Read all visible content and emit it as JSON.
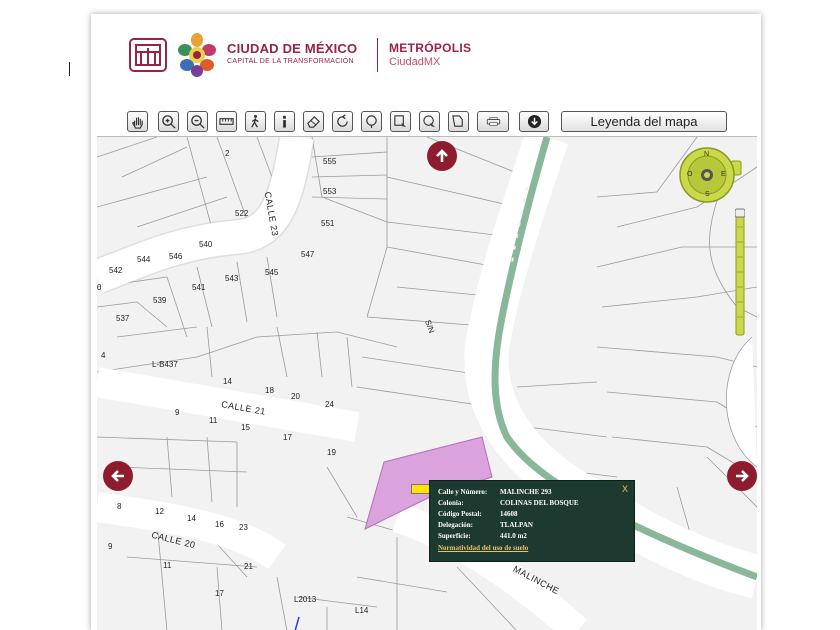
{
  "header": {
    "brand_title": "CIUDAD DE MÉXICO",
    "brand_subtitle": "CAPITAL DE LA TRANSFORMACIÓN",
    "secondary_title": "METRÓPOLIS",
    "secondary_subtitle": "CiudadMX",
    "brand_color": "#9b2247"
  },
  "toolbar": {
    "tools": [
      "pan-hand-icon",
      "zoom-in-icon",
      "zoom-out-icon",
      "ruler-icon",
      "walk-icon",
      "info-icon",
      "eraser-icon",
      "refresh-icon",
      "locate-icon",
      "select-rect-icon",
      "select-circle-icon",
      "select-polygon-icon",
      "print-icon",
      "download-icon"
    ],
    "legend_label": "Leyenda del mapa"
  },
  "map": {
    "parcel_numbers": [
      "2",
      "555",
      "553",
      "551",
      "522",
      "540",
      "547",
      "546",
      "544",
      "542",
      "541",
      "543",
      "545",
      "539",
      "537",
      "4",
      "L-B437",
      "14",
      "18",
      "20",
      "24",
      "9",
      "11",
      "15",
      "17",
      "19",
      "8",
      "12",
      "14",
      "16",
      "23",
      "9",
      "11",
      "21",
      "17",
      "L2013",
      "L14",
      "0",
      "S/N"
    ],
    "streets": [
      "CALLE 23",
      "CALLE 21",
      "CALLE 20",
      "MALINCHE"
    ],
    "compass": {
      "n": "N",
      "s": "S",
      "e": "E",
      "o": "O"
    },
    "highlight_color": "#dca2dd",
    "road_color": "#89b79a"
  },
  "popup": {
    "close_label": "X",
    "rows": [
      {
        "key": "Calle y Número:",
        "value": "MALINCHE 293"
      },
      {
        "key": "Colonia:",
        "value": "COLINAS DEL BOSQUE"
      },
      {
        "key": "Código Postal:",
        "value": "14608"
      },
      {
        "key": "Delegación:",
        "value": "TLALPAN"
      },
      {
        "key": "Superficie:",
        "value": "441.0 m2"
      }
    ],
    "link_label": "Normatividad del uso de suelo"
  }
}
